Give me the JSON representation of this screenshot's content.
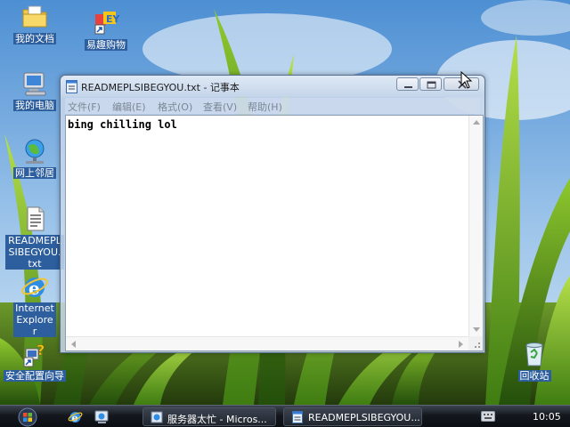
{
  "desktop": {
    "icons": [
      {
        "label": "我的文档",
        "icon": "my-documents-icon"
      },
      {
        "label": "易趣购物",
        "icon": "shopping-shortcut-icon"
      },
      {
        "label": "我的电脑",
        "icon": "my-computer-icon"
      },
      {
        "label": "网上邻居",
        "icon": "network-places-icon"
      },
      {
        "label": "READMEPLSIBEGYOU.txt",
        "icon": "text-file-icon"
      },
      {
        "label": "Internet Explorer",
        "icon": "internet-explorer-icon"
      },
      {
        "label": "安全配置向导",
        "icon": "security-wizard-icon"
      },
      {
        "label": "回收站",
        "icon": "recycle-bin-icon"
      }
    ]
  },
  "window": {
    "title": "READMEPLSIBEGYOU.txt - 记事本",
    "menu": [
      "文件(F)",
      "编辑(E)",
      "格式(O)",
      "查看(V)",
      "帮助(H)"
    ],
    "content": "bing chilling lol",
    "buttons": {
      "minimize": "minimize-icon",
      "maximize": "maximize-icon",
      "close": "close-icon"
    }
  },
  "taskbar": {
    "tasks": [
      "服务器太忙 - Micros...",
      "READMEPLSIBEGYOU..."
    ],
    "clock": "10:05",
    "quick_launch": [
      "internet-explorer-icon",
      "show-desktop-icon"
    ]
  },
  "colors": {
    "selection_blue": "#2d5e9e",
    "taskbar_dark": "#14181e"
  }
}
